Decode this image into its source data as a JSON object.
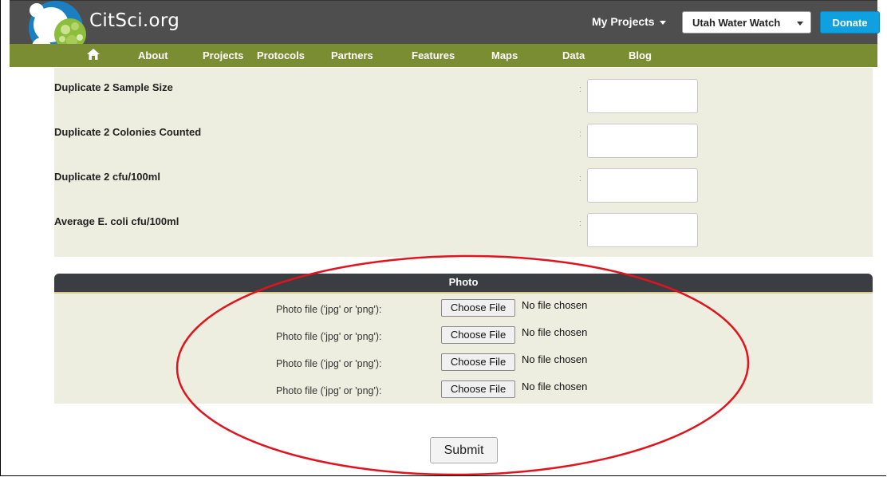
{
  "header": {
    "brand": "CitSci.org",
    "my_projects": "My Projects",
    "project_select": "Utah Water Watch",
    "donate": "Donate"
  },
  "nav": {
    "items": [
      "About",
      "Projects",
      "Protocols",
      "Partners",
      "Features",
      "Maps",
      "Data",
      "Blog"
    ]
  },
  "form": {
    "colon": ":",
    "fields": [
      {
        "label": "Duplicate 2 Sample Size",
        "value": ""
      },
      {
        "label": "Duplicate 2 Colonies Counted",
        "value": ""
      },
      {
        "label": "Duplicate 2 cfu/100ml",
        "value": ""
      },
      {
        "label": "Average E. coli cfu/100ml",
        "value": ""
      }
    ]
  },
  "photo": {
    "title": "Photo",
    "rows": [
      {
        "label": "Photo file ('jpg' or 'png'):",
        "button": "Choose File",
        "status": "No file chosen"
      },
      {
        "label": "Photo file ('jpg' or 'png'):",
        "button": "Choose File",
        "status": "No file chosen"
      },
      {
        "label": "Photo file ('jpg' or 'png'):",
        "button": "Choose File",
        "status": "No file chosen"
      },
      {
        "label": "Photo file ('jpg' or 'png'):",
        "button": "Choose File",
        "status": "No file chosen"
      }
    ]
  },
  "submit": "Submit",
  "colors": {
    "topbar": "#4e4e4e",
    "navbar": "#7b8d32",
    "panel": "#eeeee0",
    "donate": "#0fa0e0",
    "annotation": "#e0141e"
  },
  "icons": {
    "home": "home-icon",
    "logo": "citsci-logo-icon"
  }
}
